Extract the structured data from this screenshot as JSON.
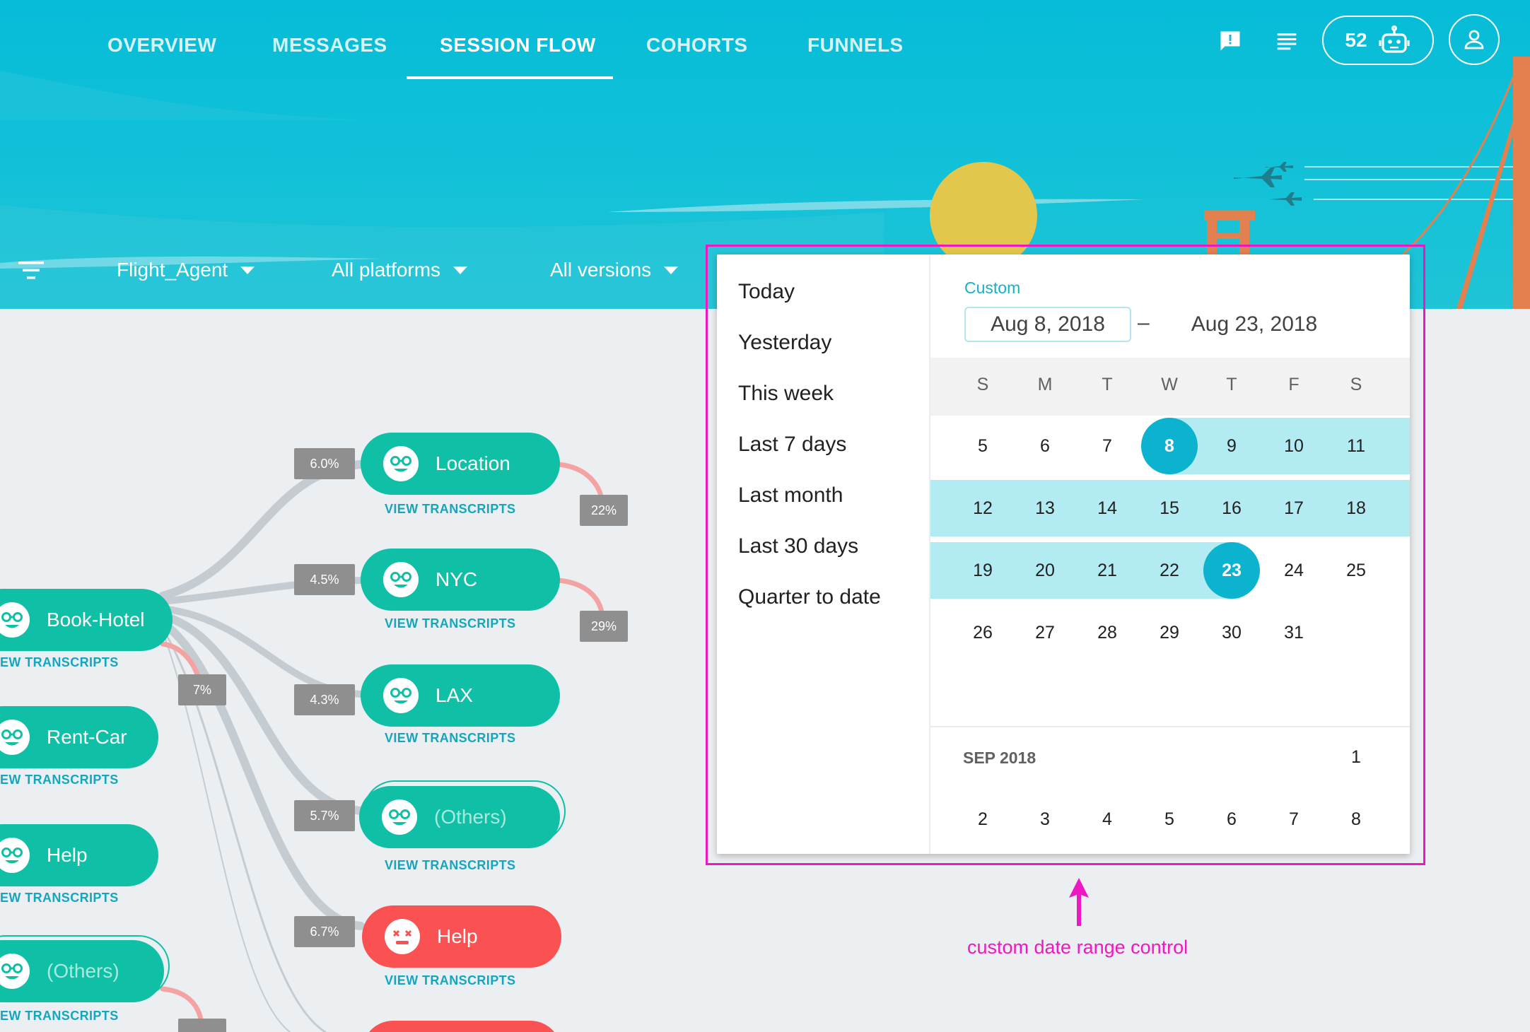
{
  "nav": {
    "tabs": [
      {
        "label": "OVERVIEW"
      },
      {
        "label": "MESSAGES"
      },
      {
        "label": "SESSION FLOW"
      },
      {
        "label": "COHORTS"
      },
      {
        "label": "FUNNELS"
      }
    ],
    "active_tab": "SESSION FLOW",
    "bot_count": "52",
    "icons": [
      "feedback-icon",
      "notes-icon",
      "robot-icon",
      "account-icon"
    ]
  },
  "filters": {
    "filter_icon": "filter-list-icon",
    "agent": "Flight_Agent",
    "platforms": "All platforms",
    "versions": "All versions"
  },
  "flow": {
    "left_nodes": [
      {
        "label": "Book-Hotel",
        "link": "EW TRANSCRIPTS"
      },
      {
        "label": "Rent-Car",
        "link": "EW TRANSCRIPTS"
      },
      {
        "label": "Help",
        "link": "EW TRANSCRIPTS"
      },
      {
        "label": "(Others)",
        "link": "EW TRANSCRIPTS"
      }
    ],
    "right_nodes": [
      {
        "label": "Location",
        "percent": "6.0%",
        "exit_percent": "22%",
        "link": "VIEW TRANSCRIPTS"
      },
      {
        "label": "NYC",
        "percent": "4.5%",
        "exit_percent": "29%",
        "link": "VIEW TRANSCRIPTS"
      },
      {
        "label": "LAX",
        "percent": "4.3%",
        "link": "VIEW TRANSCRIPTS"
      },
      {
        "label": "(Others)",
        "percent": "5.7%",
        "link": "VIEW TRANSCRIPTS"
      },
      {
        "label": "Help",
        "percent": "6.7%",
        "link": "VIEW TRANSCRIPTS"
      }
    ],
    "book_hotel_exit_percent": "7%",
    "colors": {
      "ok": "#0fbfa6",
      "error": "#fa5252",
      "link": "#14a6bf",
      "flow": "#c5ccd1",
      "exit": "#f4a3a3"
    }
  },
  "date_picker": {
    "presets": [
      "Today",
      "Yesterday",
      "This week",
      "Last 7 days",
      "Last month",
      "Last 30 days",
      "Quarter to date"
    ],
    "custom_label": "Custom",
    "start_date": "Aug 8, 2018",
    "range_separator": "–",
    "end_date": "Aug 23, 2018",
    "weekdays": [
      "S",
      "M",
      "T",
      "W",
      "T",
      "F",
      "S"
    ],
    "aug_weeks": [
      [
        "5",
        "6",
        "7",
        "8",
        "9",
        "10",
        "11"
      ],
      [
        "12",
        "13",
        "14",
        "15",
        "16",
        "17",
        "18"
      ],
      [
        "19",
        "20",
        "21",
        "22",
        "23",
        "24",
        "25"
      ],
      [
        "26",
        "27",
        "28",
        "29",
        "30",
        "31",
        ""
      ]
    ],
    "selected_start": "8",
    "selected_end": "23",
    "next_month_label": "SEP 2018",
    "sep_first_row": [
      "",
      "",
      "",
      "",
      "",
      "",
      "1"
    ],
    "sep_second_row": [
      "2",
      "3",
      "4",
      "5",
      "6",
      "7",
      "8"
    ],
    "accent_color": "#0cb3cf",
    "range_color": "#b2ebf2"
  },
  "annotation": {
    "text": "custom date range control",
    "color": "#ef17c1"
  }
}
